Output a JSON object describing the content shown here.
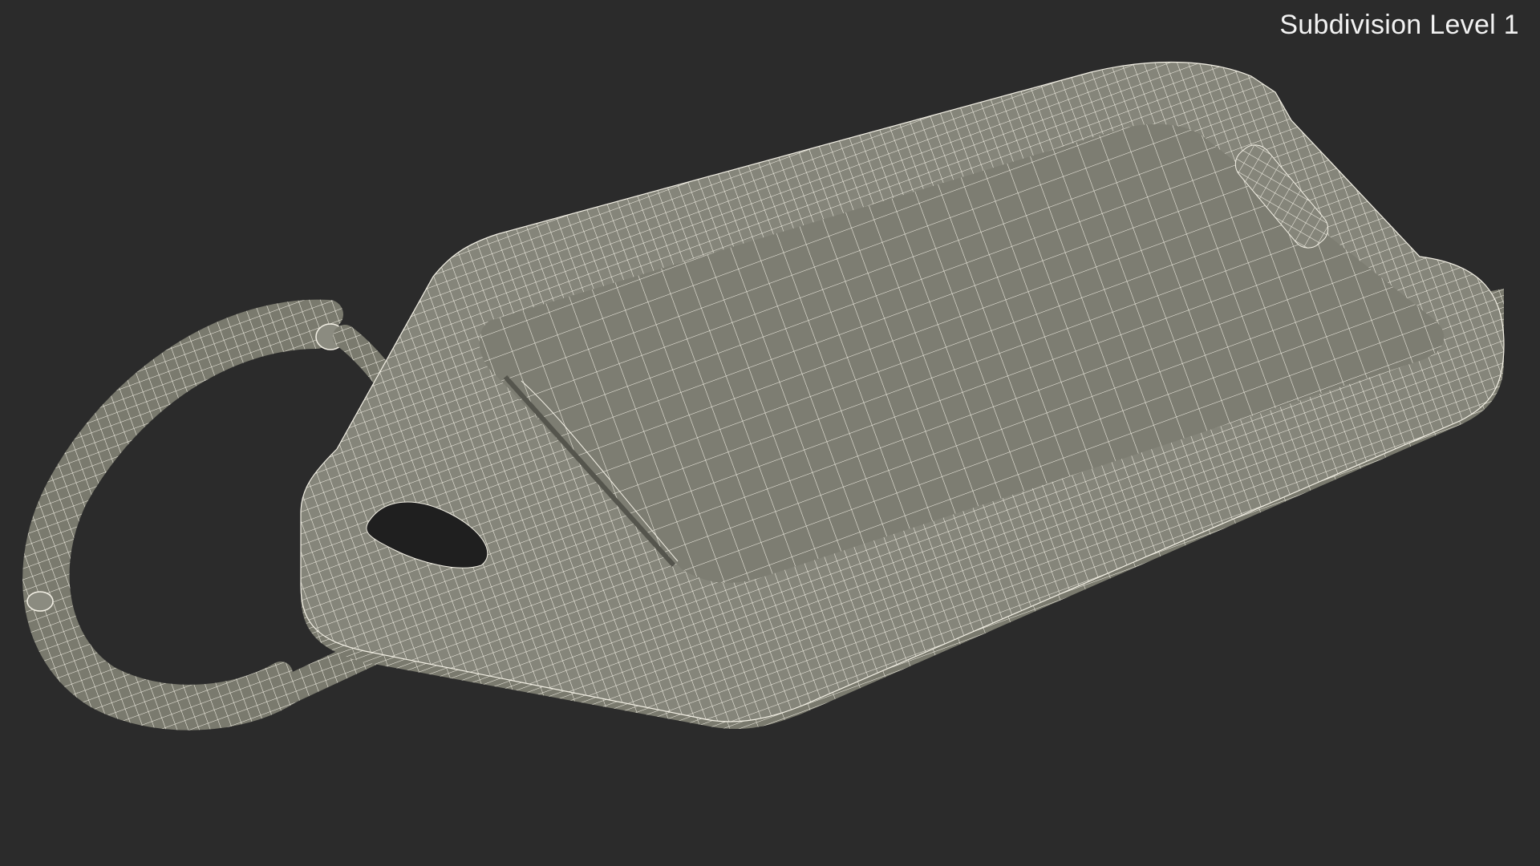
{
  "overlay": {
    "label": "Subdivision Level 1"
  },
  "colors": {
    "background": "#2b2b2b",
    "surface": "#7a7a6e",
    "surface_light": "#8b8b80",
    "wire": "#f4f1e6",
    "label": "#f2f2f2"
  },
  "subject": {
    "name": "key-tag-with-split-ring-wireframe"
  }
}
